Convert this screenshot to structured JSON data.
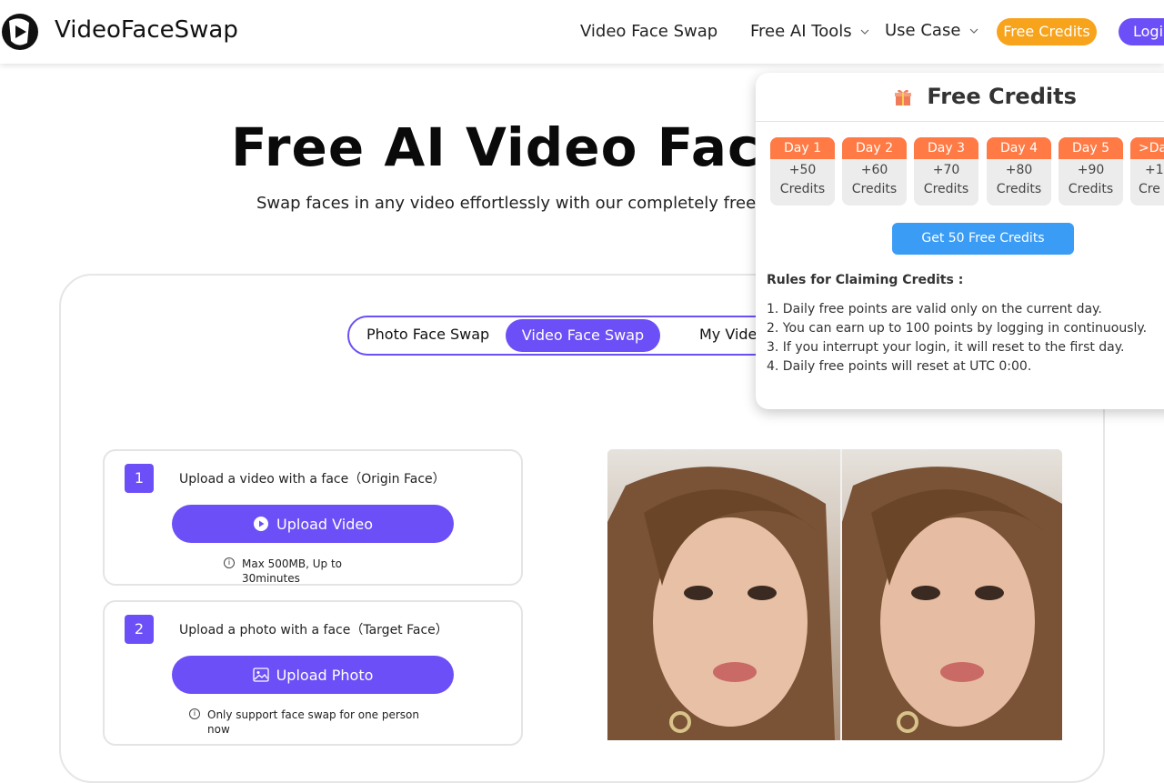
{
  "header": {
    "brand": "VideoFaceSwap",
    "nav": [
      {
        "label": "Video Face Swap"
      },
      {
        "label": "Free AI Tools"
      },
      {
        "label": "Use Case"
      }
    ],
    "free_credits": "Free Credits",
    "login": "Login"
  },
  "hero": {
    "title": "Free AI Video Face",
    "subtitle": "Swap faces in any video effortlessly with our completely free"
  },
  "tabs": [
    {
      "label": "Photo Face Swap"
    },
    {
      "label": "Video Face Swap"
    },
    {
      "label": "My Vide"
    }
  ],
  "steps": [
    {
      "num": "1",
      "label": "Upload a video with a face（Origin Face）",
      "button": "Upload Video",
      "note_line1": "Max 500MB, Up to",
      "note_line2": "30minutes"
    },
    {
      "num": "2",
      "label": "Upload a photo with a face（Target Face）",
      "button": "Upload Photo",
      "note_line1": "Only support face swap for one person",
      "note_line2": "now"
    }
  ],
  "popup": {
    "title": "Free Credits",
    "days": [
      {
        "day": "Day 1",
        "amount": "+50",
        "unit": "Credits"
      },
      {
        "day": "Day 2",
        "amount": "+60",
        "unit": "Credits"
      },
      {
        "day": "Day 3",
        "amount": "+70",
        "unit": "Credits"
      },
      {
        "day": "Day 4",
        "amount": "+80",
        "unit": "Credits"
      },
      {
        "day": "Day 5",
        "amount": "+90",
        "unit": "Credits"
      },
      {
        "day": ">Da",
        "amount": "+1",
        "unit": "Cre"
      }
    ],
    "get_button": "Get 50 Free Credits",
    "rules_title": "Rules for Claiming Credits :",
    "rules": [
      "1. Daily free points are valid only on the current day.",
      "2. You can earn up to 100 points by logging in continuously.",
      "3. If you interrupt your login, it will reset to the first day.",
      "4. Daily free points will reset at UTC 0:00."
    ]
  },
  "colors": {
    "primary": "#6c4ff6",
    "accent_orange": "#f7a31c",
    "day_header": "#ff7a45",
    "get_button": "#3a9cf5"
  }
}
